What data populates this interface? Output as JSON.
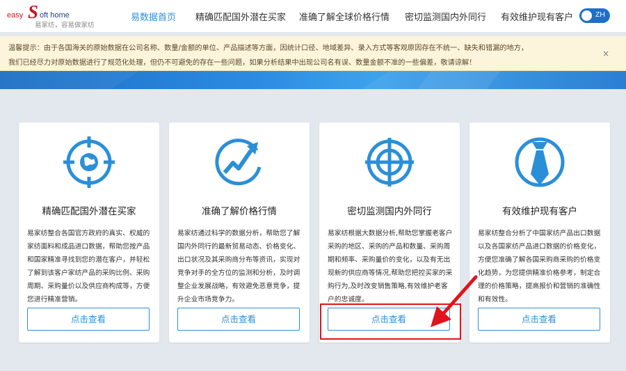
{
  "logo": {
    "easy": "easy",
    "s": "S",
    "oft": "oft home",
    "subtitle": "易家纺，容易做家纺"
  },
  "nav": {
    "items": [
      "易数据首页",
      "精确匹配国外潜在买家",
      "准确了解全球价格行情",
      "密切监测国内外同行",
      "有效维护现有客户"
    ],
    "active_index": 0
  },
  "lang_toggle": {
    "label": "ZH"
  },
  "notice": {
    "line1": "温馨提示：由于各国海关的原始数据在公司名称、数量/金额的单位、产品描述等方面，因统计口径、地域差异、录入方式等客观原因存在不统一、缺失和错漏的地方，",
    "line2": "我们已经尽力对原始数据进行了规范化处理，但仍不可避免的存在一些问题，如果分析结果中出现公司名有误、数量金额不准的一些偏差，敬请谅解！",
    "close": "×"
  },
  "colors": {
    "accent": "#2b8fd8",
    "brand_red": "#c8161d",
    "brand_blue": "#1e3f8a",
    "highlight": "#e0141c"
  },
  "cards": [
    {
      "icon": "globe-target-icon",
      "title": "精确匹配国外潜在买家",
      "desc": "易家纺整合各国官方政府的真实、权威的家纺面料和成品进口数据，帮助您按产品和国家精准寻找到您的潜在客户，并轻松了解到该客户家纺产品的采购比例、采购周期、采购量价以及供应商构成等，方便您进行精准营销。",
      "button": "点击查看"
    },
    {
      "icon": "trend-arrow-icon",
      "title": "准确了解价格行情",
      "desc": "易家纺通过科学的数据分析，帮助您了解国内外同行的最新贸易动态、价格变化、出口状况及其采购商分布等资讯，实现对竞争对手的全方位的监测和分析，及时调整企业发展战略，有效避免恶意竞争，提升企业市场竞争力。",
      "button": "点击查看"
    },
    {
      "icon": "crosshair-icon",
      "title": "密切监测国内外同行",
      "desc": "易家纺根据大数据分析,帮助您掌握老客户采购的地区、采购的产品和数量、采购周期和频率、采购量价的变化，以及有无出现新的供应商等情况,帮助您把控买家的采购行为,及时改变销售策略,有效维护老客户的忠诚度。",
      "button": "点击查看"
    },
    {
      "icon": "necktie-icon",
      "title": "有效维护现有客户",
      "desc": "易家纺整合分析了中国家纺产品出口数据以及各国家纺产品进口数据的价格变化，方便您准确了解各国采购商采购的价格变化趋势，为您提供精准价格参考，制定合理的价格策略，提高报价和营销的准确性和有效性。",
      "button": "点击查看"
    }
  ]
}
